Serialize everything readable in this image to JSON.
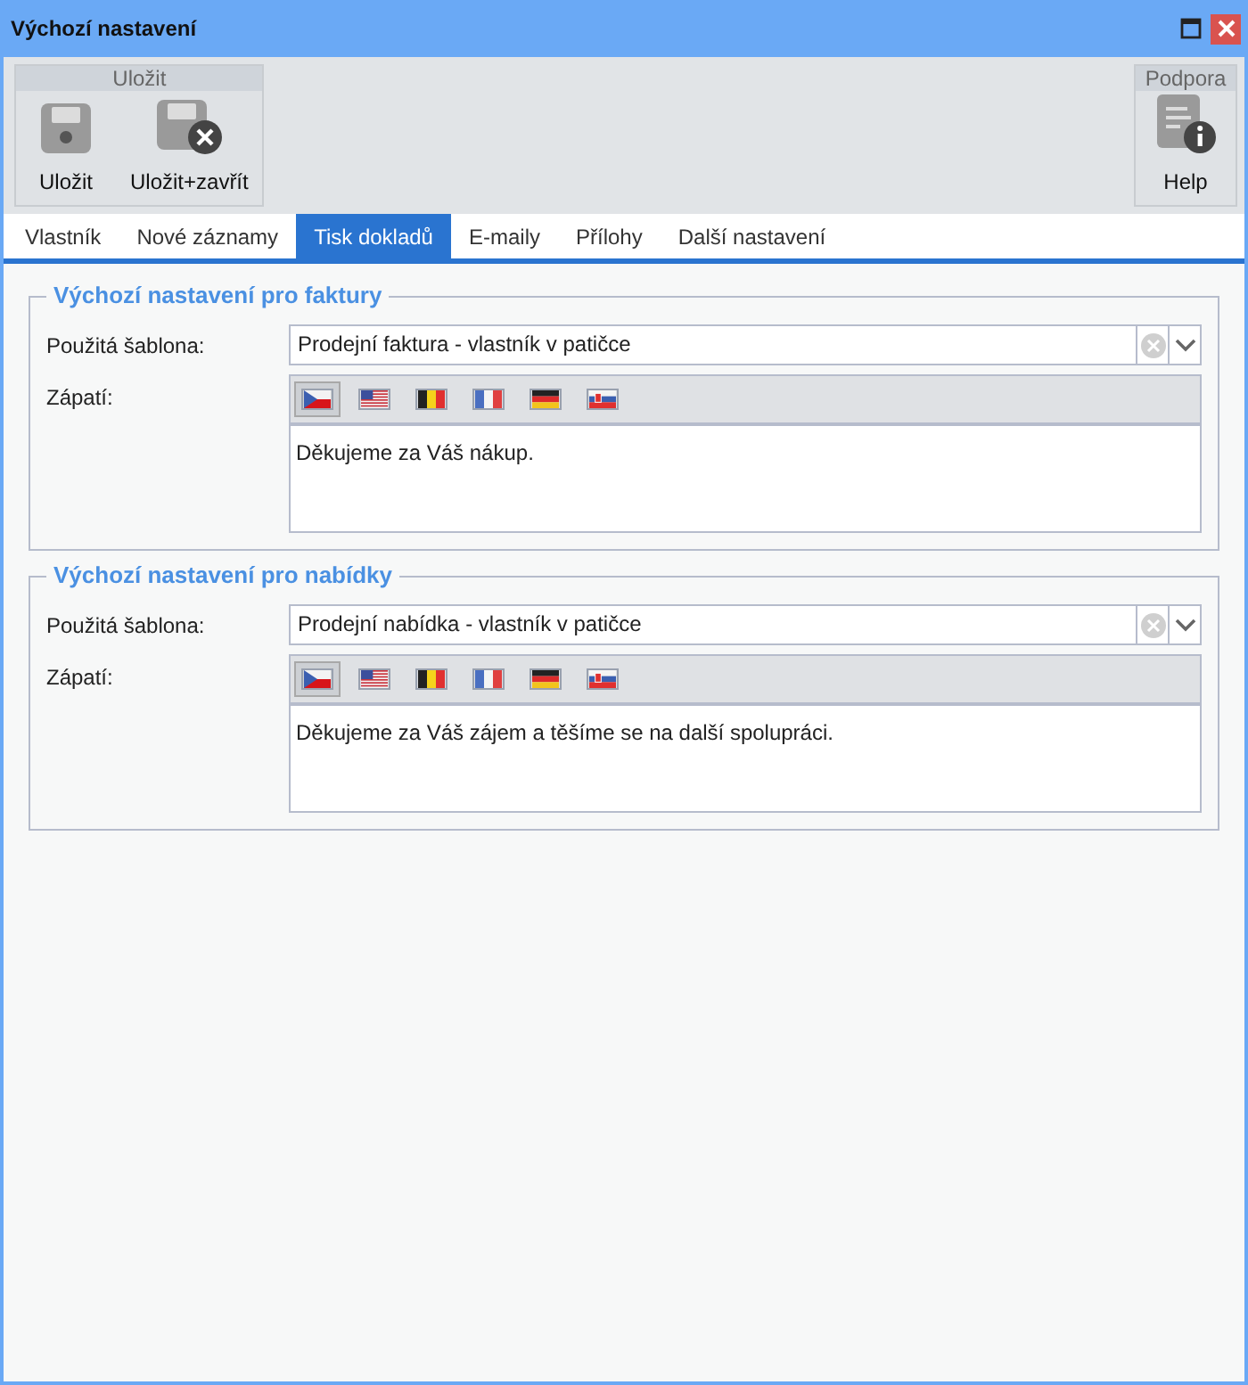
{
  "window": {
    "title": "Výchozí nastavení"
  },
  "ribbon": [
    {
      "title": "Uložit",
      "buttons": [
        {
          "label": "Uložit",
          "kind": "save"
        },
        {
          "label": "Uložit+zavřít",
          "kind": "save-close"
        }
      ]
    },
    {
      "title": "Podpora",
      "buttons": [
        {
          "label": "Help",
          "kind": "help"
        }
      ]
    }
  ],
  "tabs": [
    {
      "label": "Vlastník",
      "selected": false
    },
    {
      "label": "Nové záznamy",
      "selected": false
    },
    {
      "label": "Tisk dokladů",
      "selected": true
    },
    {
      "label": "E-maily",
      "selected": false
    },
    {
      "label": "Přílohy",
      "selected": false
    },
    {
      "label": "Další nastavení",
      "selected": false
    }
  ],
  "sections": [
    {
      "title": "Výchozí nastavení pro faktury",
      "template_label": "Použitá šablona:",
      "template_value": "Prodejní faktura - vlastník v patičce",
      "footer_label": "Zápatí:",
      "flags": [
        {
          "kind": "cz",
          "selected": true
        },
        {
          "kind": "us",
          "selected": false
        },
        {
          "kind": "be",
          "selected": false
        },
        {
          "kind": "fr",
          "selected": false
        },
        {
          "kind": "de",
          "selected": false
        },
        {
          "kind": "sk",
          "selected": false
        }
      ],
      "footer_text": "Děkujeme za Váš nákup."
    },
    {
      "title": "Výchozí nastavení pro nabídky",
      "template_label": "Použitá šablona:",
      "template_value": "Prodejní nabídka - vlastník v patičce",
      "footer_label": "Zápatí:",
      "flags": [
        {
          "kind": "cz",
          "selected": true
        },
        {
          "kind": "us",
          "selected": false
        },
        {
          "kind": "be",
          "selected": false
        },
        {
          "kind": "fr",
          "selected": false
        },
        {
          "kind": "de",
          "selected": false
        },
        {
          "kind": "sk",
          "selected": false
        }
      ],
      "footer_text": "Děkujeme za Váš zájem a těšíme se na další spolupráci."
    }
  ]
}
